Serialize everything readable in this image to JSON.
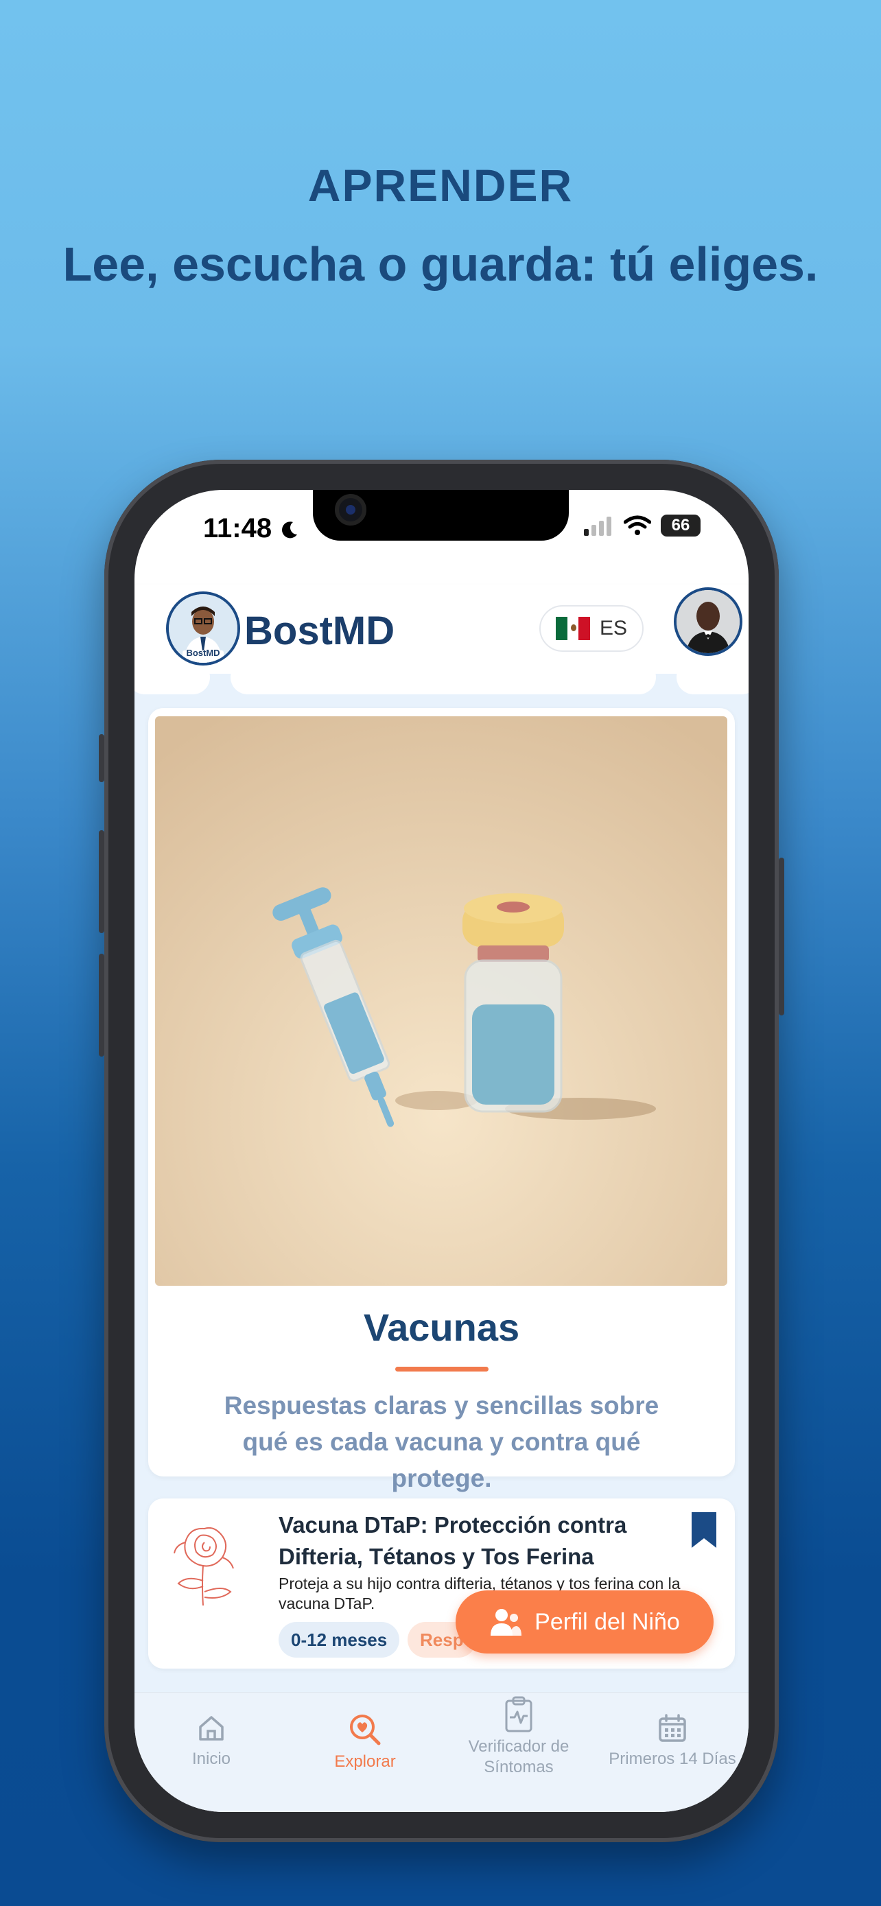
{
  "hero": {
    "kicker": "APRENDER",
    "title": "Lee, escucha o guarda: tú eliges."
  },
  "status_bar": {
    "time": "11:48",
    "battery": "66"
  },
  "app_header": {
    "brand": "BostMD",
    "logo_caption": "BostMD",
    "language": "ES"
  },
  "topic_card": {
    "title": "Vacunas",
    "description": "Respuestas claras y sencillas sobre qué es cada vacuna y contra qué protege."
  },
  "article": {
    "title": "Vacuna DTaP: Protección contra Difteria, Tétanos y Tos Ferina",
    "description": "Proteja a su hijo contra difteria, tétanos y tos ferina con la vacuna DTaP.",
    "tags": [
      "0-12 meses",
      "Resp"
    ]
  },
  "fab": {
    "label": "Perfil del Niño"
  },
  "bottom_nav": {
    "items": [
      {
        "label": "Inicio",
        "icon": "home-icon"
      },
      {
        "label": "Explorar",
        "icon": "explore-search-icon"
      },
      {
        "label": "Verificador de Síntomas",
        "icon": "clipboard-pulse-icon"
      },
      {
        "label": "Primeros 14 Días",
        "icon": "calendar-icon"
      }
    ],
    "active": "Explorar"
  },
  "colors": {
    "brand_navy": "#1b3e6b",
    "accent_orange": "#fb7f4a",
    "muted_text": "#7a93b5"
  }
}
